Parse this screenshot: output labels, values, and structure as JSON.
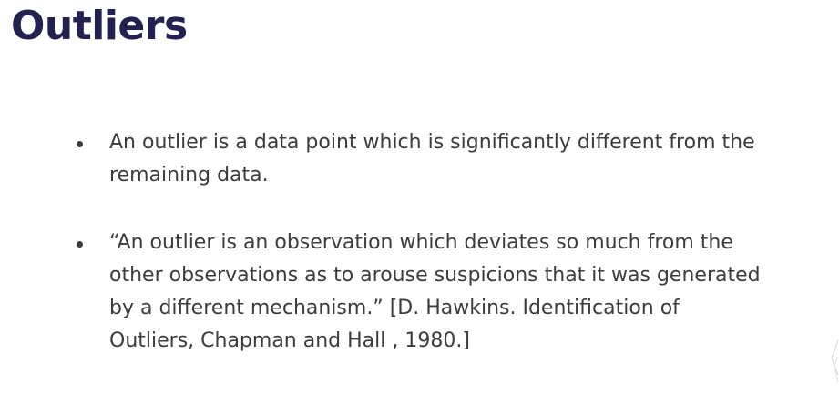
{
  "slide": {
    "title": "Outliers",
    "bullets": [
      {
        "lines": [
          "An outlier is a data point which is significantly different from the",
          "remaining data."
        ]
      },
      {
        "lines": [
          "“An outlier is an observation which deviates so much from the",
          "other observations as to arouse suspicions that it was generated",
          "by a different mechanism.” [D. Hawkins. Identification of",
          "Outliers, Chapman and Hall , 1980.]"
        ]
      }
    ]
  },
  "colors": {
    "title": "#22214f",
    "body_text": "#3c3c3c",
    "background": "#ffffff"
  }
}
